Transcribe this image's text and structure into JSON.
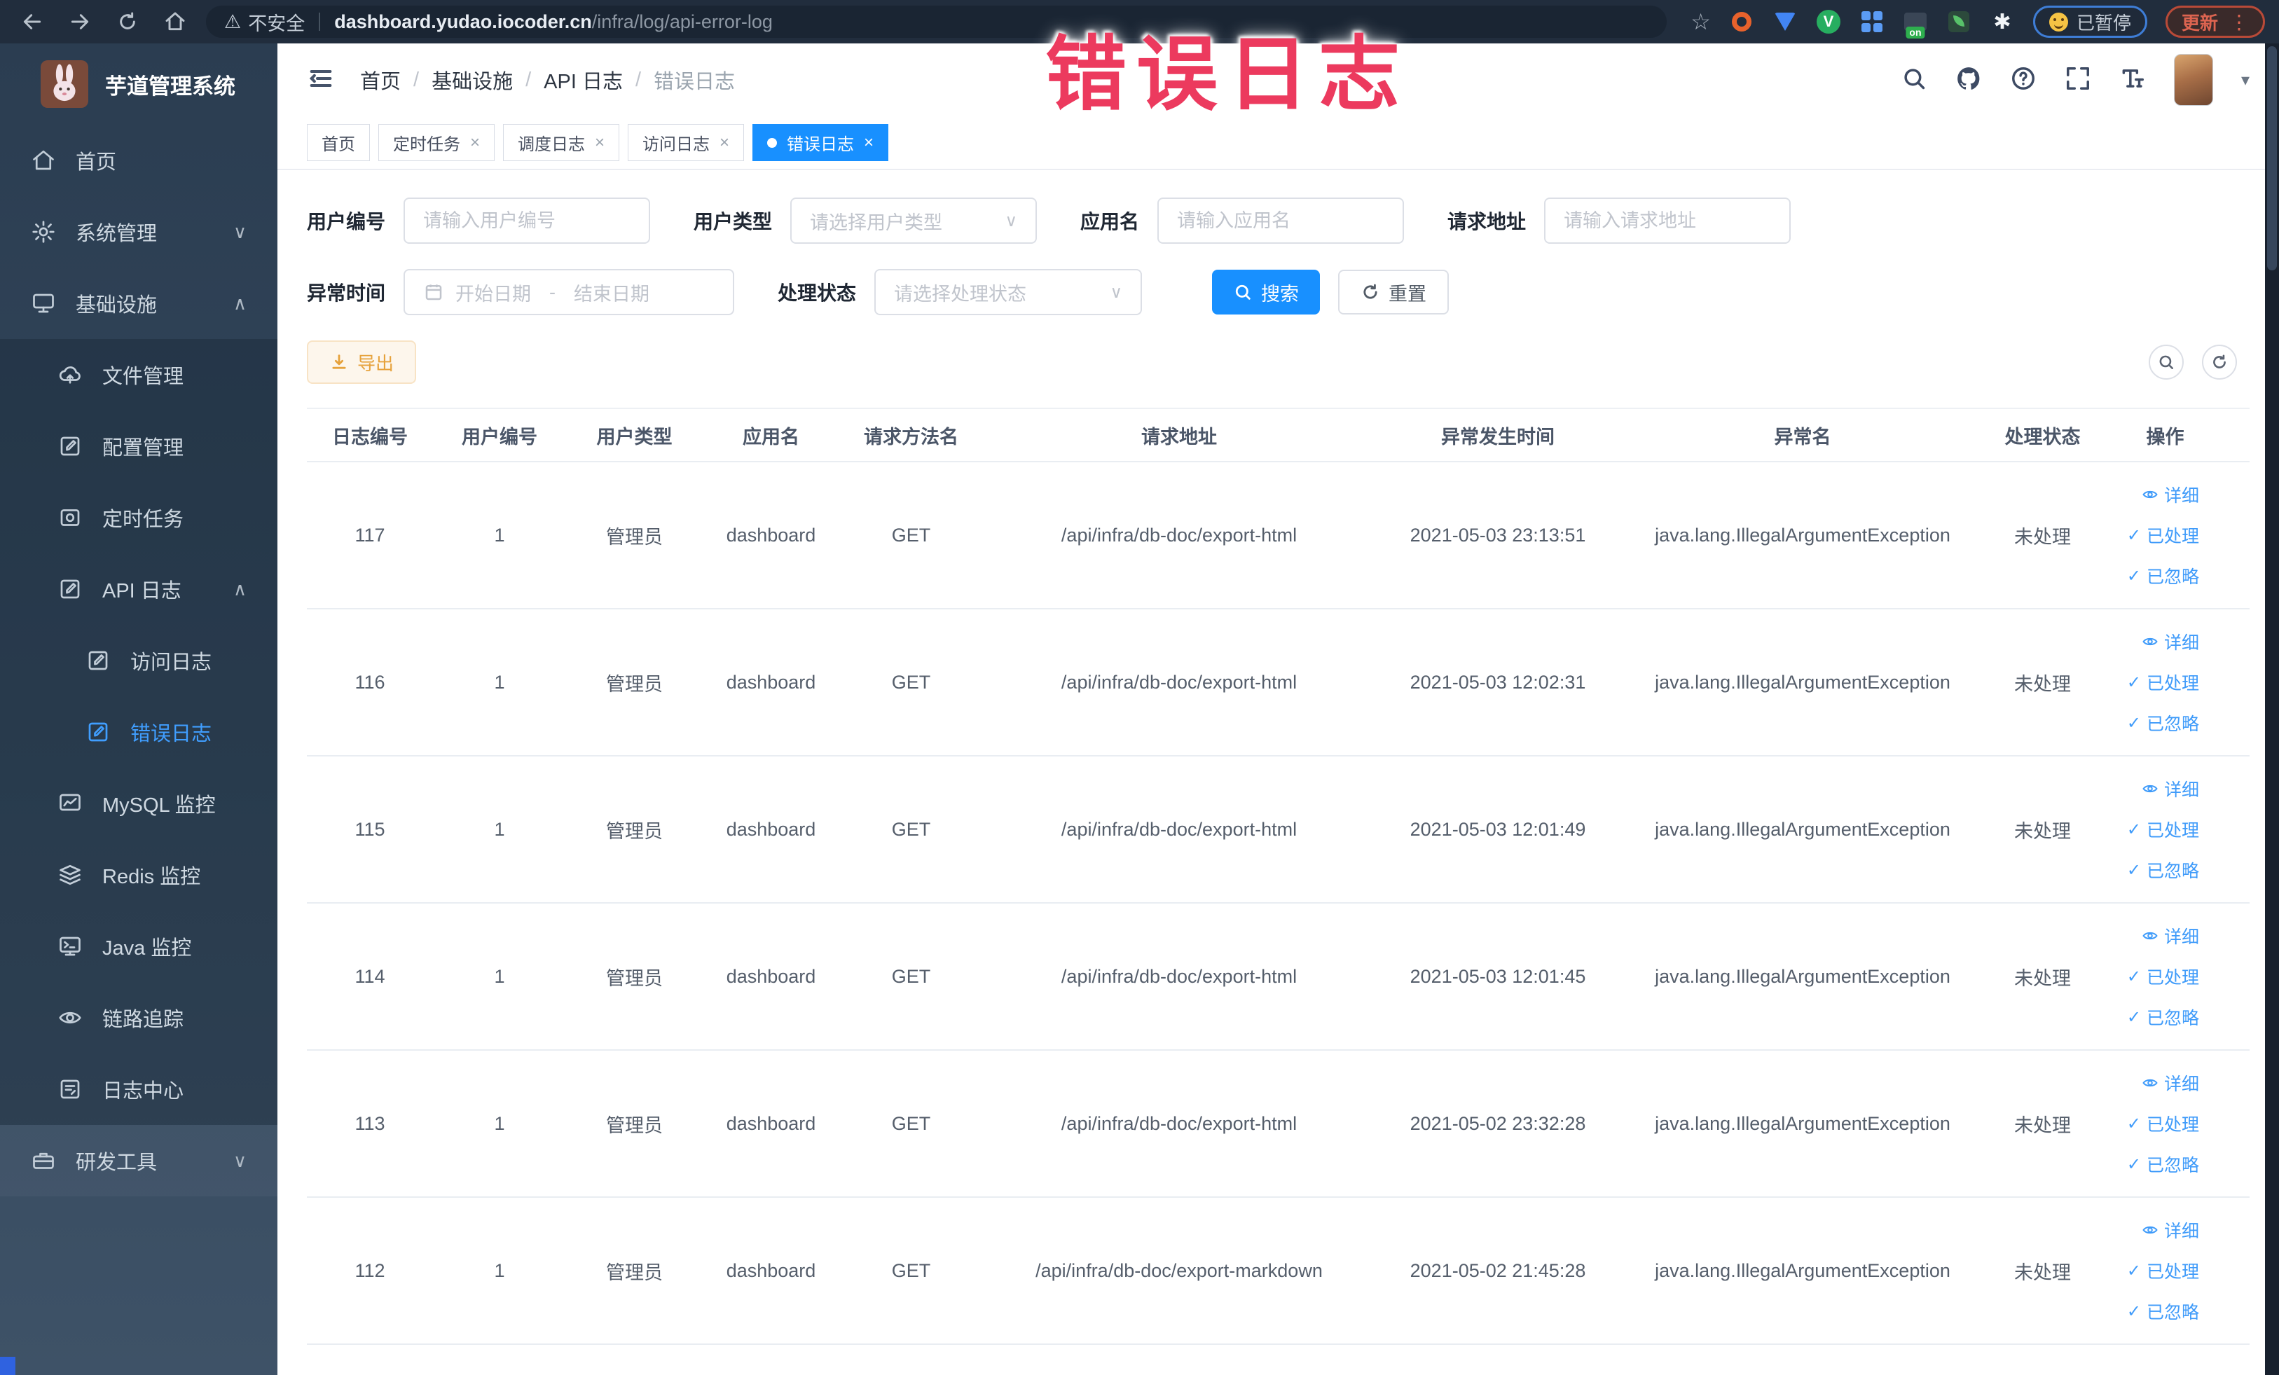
{
  "browser": {
    "security_label": "不安全",
    "url_host": "dashboard.yudao.iocoder.cn",
    "url_path": "/infra/log/api-error-log",
    "extension_badge": "on",
    "paused_label": "已暂停",
    "update_label": "更新"
  },
  "header": {
    "breadcrumb": [
      "首页",
      "基础设施",
      "API 日志",
      "错误日志"
    ]
  },
  "tabs": [
    {
      "label": "首页",
      "closable": false,
      "active": false
    },
    {
      "label": "定时任务",
      "closable": true,
      "active": false
    },
    {
      "label": "调度日志",
      "closable": true,
      "active": false
    },
    {
      "label": "访问日志",
      "closable": true,
      "active": false
    },
    {
      "label": "错误日志",
      "closable": true,
      "active": true
    }
  ],
  "sidebar": {
    "logo_title": "芋道管理系统",
    "menu": {
      "home": "首页",
      "system": "系统管理",
      "infra": "基础设施",
      "file": "文件管理",
      "config": "配置管理",
      "job": "定时任务",
      "api_log": "API 日志",
      "access_log": "访问日志",
      "error_log": "错误日志",
      "mysql": "MySQL 监控",
      "redis": "Redis 监控",
      "java": "Java 监控",
      "trace": "链路追踪",
      "log_center": "日志中心",
      "dev_tools": "研发工具"
    }
  },
  "filters": {
    "user_id": {
      "label": "用户编号",
      "placeholder": "请输入用户编号"
    },
    "user_type": {
      "label": "用户类型",
      "placeholder": "请选择用户类型"
    },
    "app_name": {
      "label": "应用名",
      "placeholder": "请输入应用名"
    },
    "request_url": {
      "label": "请求地址",
      "placeholder": "请输入请求地址"
    },
    "exception_time": {
      "label": "异常时间",
      "start_placeholder": "开始日期",
      "separator": "-",
      "end_placeholder": "结束日期"
    },
    "process_status": {
      "label": "处理状态",
      "placeholder": "请选择处理状态"
    },
    "search_label": "搜索",
    "reset_label": "重置"
  },
  "toolbar": {
    "export_label": "导出"
  },
  "table": {
    "columns": [
      "日志编号",
      "用户编号",
      "用户类型",
      "应用名",
      "请求方法名",
      "请求地址",
      "异常发生时间",
      "异常名",
      "处理状态",
      "操作"
    ],
    "actions": {
      "detail": "详细",
      "processed": "已处理",
      "ignored": "已忽略"
    },
    "rows": [
      {
        "id": "117",
        "user_id": "1",
        "user_type": "管理员",
        "app_name": "dashboard",
        "method": "GET",
        "url": "/api/infra/db-doc/export-html",
        "time": "2021-05-03 23:13:51",
        "exception": "java.lang.IllegalArgumentException",
        "status": "未处理"
      },
      {
        "id": "116",
        "user_id": "1",
        "user_type": "管理员",
        "app_name": "dashboard",
        "method": "GET",
        "url": "/api/infra/db-doc/export-html",
        "time": "2021-05-03 12:02:31",
        "exception": "java.lang.IllegalArgumentException",
        "status": "未处理"
      },
      {
        "id": "115",
        "user_id": "1",
        "user_type": "管理员",
        "app_name": "dashboard",
        "method": "GET",
        "url": "/api/infra/db-doc/export-html",
        "time": "2021-05-03 12:01:49",
        "exception": "java.lang.IllegalArgumentException",
        "status": "未处理"
      },
      {
        "id": "114",
        "user_id": "1",
        "user_type": "管理员",
        "app_name": "dashboard",
        "method": "GET",
        "url": "/api/infra/db-doc/export-html",
        "time": "2021-05-03 12:01:45",
        "exception": "java.lang.IllegalArgumentException",
        "status": "未处理"
      },
      {
        "id": "113",
        "user_id": "1",
        "user_type": "管理员",
        "app_name": "dashboard",
        "method": "GET",
        "url": "/api/infra/db-doc/export-html",
        "time": "2021-05-02 23:32:28",
        "exception": "java.lang.IllegalArgumentException",
        "status": "未处理"
      },
      {
        "id": "112",
        "user_id": "1",
        "user_type": "管理员",
        "app_name": "dashboard",
        "method": "GET",
        "url": "/api/infra/db-doc/export-markdown",
        "time": "2021-05-02 21:45:28",
        "exception": "java.lang.IllegalArgumentException",
        "status": "未处理"
      }
    ]
  },
  "annotation": {
    "text": "错误日志"
  },
  "icons": {
    "close": "×",
    "check": "✓",
    "caret": "▾",
    "chevron_down": "∨",
    "chevron_up": "∧",
    "slash": "/",
    "star": "☆",
    "warning": "⚠",
    "dots": "⋮"
  },
  "colors": {
    "accent": "#1890ff",
    "sidebar_bg": "#304156",
    "warning": "#e6a23c",
    "annotation_text": "#ec3a5e",
    "link": "#3f9bfa"
  }
}
